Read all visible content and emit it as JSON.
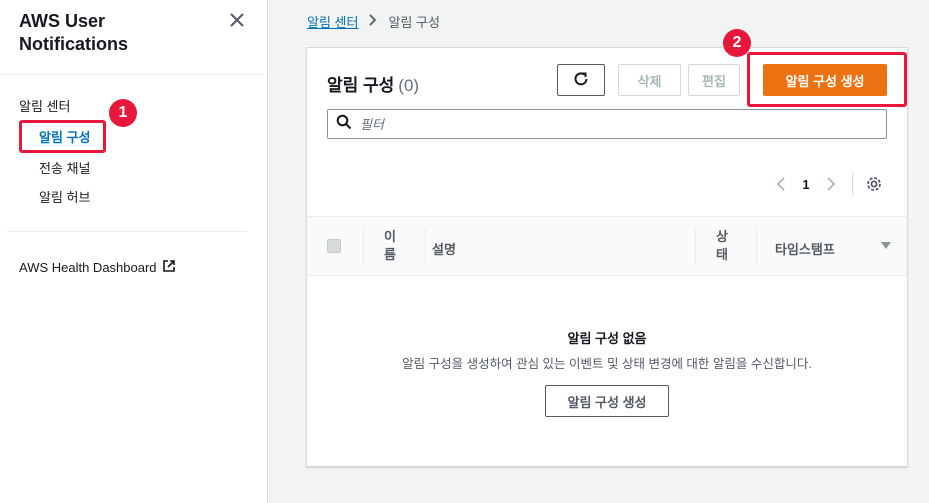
{
  "sidebar": {
    "title_line1": "AWS User",
    "title_line2": "Notifications",
    "section": "알림 센터",
    "items": [
      {
        "label": "알림 구성",
        "active": true
      },
      {
        "label": "전송 채널",
        "active": false
      },
      {
        "label": "알림 허브",
        "active": false
      }
    ],
    "external_link": "AWS Health Dashboard"
  },
  "breadcrumb": {
    "parent": "알림 센터",
    "current": "알림 구성"
  },
  "panel": {
    "title": "알림 구성",
    "count": "(0)",
    "delete_label": "삭제",
    "edit_label": "편집",
    "create_label": "알림 구성 생성",
    "search_placeholder": "필터",
    "page": "1"
  },
  "table": {
    "headers": {
      "name": [
        "이",
        "름"
      ],
      "description": "설명",
      "status": [
        "상",
        "태"
      ],
      "timestamp": "타임스탬프"
    }
  },
  "empty_state": {
    "title": "알림 구성 없음",
    "description": "알림 구성을 생성하여 관심 있는 이벤트 및 상태 변경에 대한 알림을 수신합니다.",
    "button": "알림 구성 생성"
  },
  "annotations": {
    "badge1": "1",
    "badge2": "2"
  },
  "colors": {
    "accent": "#ec7211",
    "link": "#0073bb",
    "highlight": "#e8173b"
  }
}
